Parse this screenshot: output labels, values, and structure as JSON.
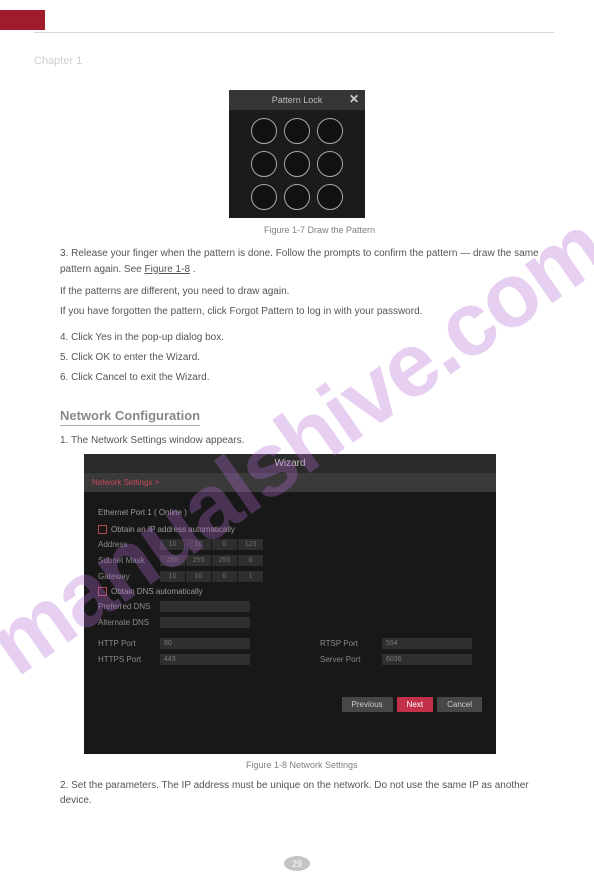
{
  "page": {
    "section_label": "Chapter 1",
    "number": "29"
  },
  "watermark": "manualshive.com",
  "pattern_lock": {
    "title": "Pattern Lock",
    "caption": "Figure 1-7 Draw the Pattern"
  },
  "steps_mid": {
    "a": "3. Release your finger when the pattern is done. Follow the prompts to confirm the pattern — draw the same pattern again. See ",
    "a_link": "Figure 1-8",
    "a_tail": ".",
    "b": "If the patterns are different, you need to draw again.",
    "c": "If you have forgotten the pattern, click Forgot Pattern to log in with your password.",
    "s4": "4. Click Yes in the pop-up dialog box.",
    "s5": "5. Click OK to enter the Wizard.",
    "s6": "6. Click Cancel to exit the Wizard."
  },
  "heading": "Network Configuration",
  "network_step": "1. The Network Settings window appears.",
  "wizard": {
    "title": "Wizard",
    "subtitle": "Network Settings >",
    "section": "Ethernet Port 1 ( Online )",
    "chk1": "Obtain an IP address automatically",
    "chk2": "Obtain DNS automatically",
    "rows": {
      "address_label": "Address",
      "address": [
        "10",
        "10",
        "0",
        "123"
      ],
      "mask_label": "Subnet Mask",
      "mask": [
        "255",
        "255",
        "255",
        "0"
      ],
      "gateway_label": "Gateway",
      "gateway": [
        "10",
        "10",
        "0",
        "1"
      ],
      "pdns_label": "Preferred DNS",
      "pdns": "",
      "adns_label": "Alternate DNS",
      "adns": "",
      "http_label": "HTTP Port",
      "http": "80",
      "https_label": "HTTPS Port",
      "https": "443",
      "rtsp_label": "RTSP Port",
      "rtsp": "554",
      "server_label": "Server Port",
      "server": "6036"
    },
    "buttons": {
      "prev": "Previous",
      "next": "Next",
      "cancel": "Cancel"
    },
    "caption": "Figure 1-8 Network Settings"
  },
  "trailing": "2. Set the parameters. The IP address must be unique on the network. Do not use the same IP as another device."
}
